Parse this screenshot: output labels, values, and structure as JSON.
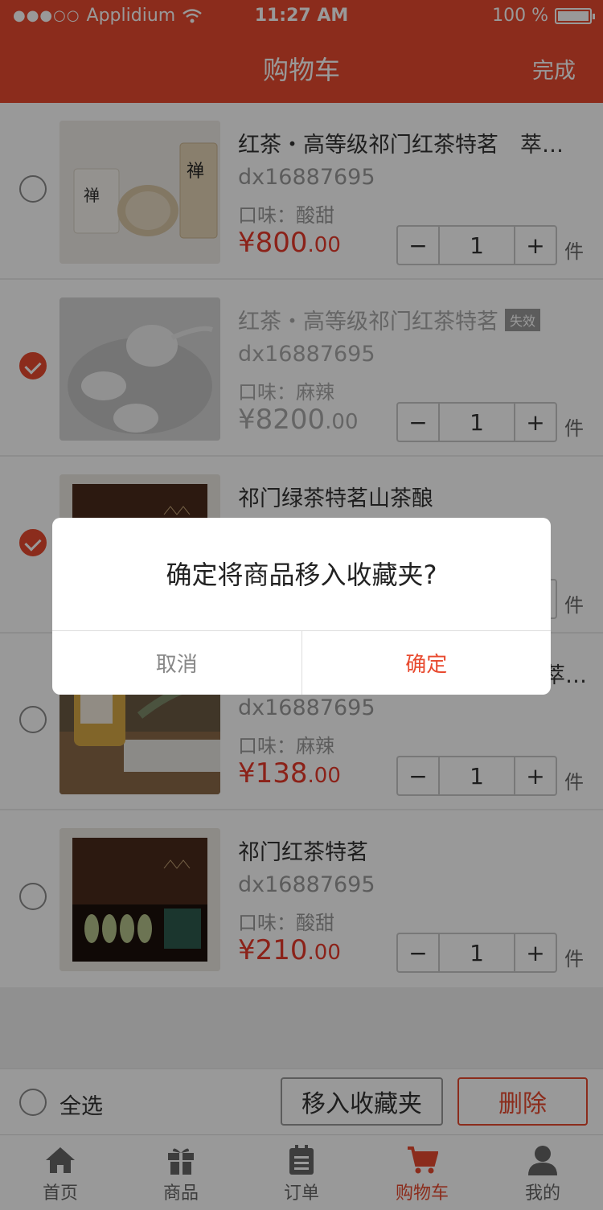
{
  "status": {
    "carrier": "Applidium",
    "time": "11:27 AM",
    "battery": "100 %"
  },
  "nav": {
    "title": "购物车",
    "done": "完成"
  },
  "items": [
    {
      "name": "红茶・高等级祁门红茶特茗　萃…",
      "sku": "dx16887695",
      "flavor": "口味：酸甜",
      "price_int": "¥800",
      "price_dec": ".00",
      "qty": "1",
      "unit": "件",
      "checked": false,
      "invalid": false,
      "badge": ""
    },
    {
      "name": "红茶・高等级祁门红茶特茗",
      "sku": "dx16887695",
      "flavor": "口味：麻辣",
      "price_int": "¥8200",
      "price_dec": ".00",
      "qty": "1",
      "unit": "件",
      "checked": true,
      "invalid": true,
      "badge": "失效"
    },
    {
      "name": "祁门绿茶特茗山茶酿",
      "sku": "",
      "flavor": "",
      "price_int": "",
      "price_dec": "",
      "qty": "",
      "unit": "件",
      "checked": true,
      "invalid": false,
      "badge": ""
    },
    {
      "name": "萃…",
      "sku": "dx16887695",
      "flavor": "口味：麻辣",
      "price_int": "¥138",
      "price_dec": ".00",
      "qty": "1",
      "unit": "件",
      "checked": false,
      "invalid": false,
      "badge": ""
    },
    {
      "name": "祁门红茶特茗",
      "sku": "dx16887695",
      "flavor": "口味：酸甜",
      "price_int": "¥210",
      "price_dec": ".00",
      "qty": "1",
      "unit": "件",
      "checked": false,
      "invalid": false,
      "badge": ""
    }
  ],
  "stepper": {
    "minus": "−",
    "plus": "+"
  },
  "actions": {
    "select_all": "全选",
    "move_to_fav": "移入收藏夹",
    "delete": "删除"
  },
  "tabs": [
    {
      "label": "首页",
      "icon": "home-icon"
    },
    {
      "label": "商品",
      "icon": "gift-icon"
    },
    {
      "label": "订单",
      "icon": "order-icon"
    },
    {
      "label": "购物车",
      "icon": "cart-icon"
    },
    {
      "label": "我的",
      "icon": "user-icon"
    }
  ],
  "dialog": {
    "message": "确定将商品移入收藏夹?",
    "cancel": "取消",
    "confirm": "确定"
  },
  "colors": {
    "accent": "#e84a2f",
    "price": "#e83a2a"
  }
}
